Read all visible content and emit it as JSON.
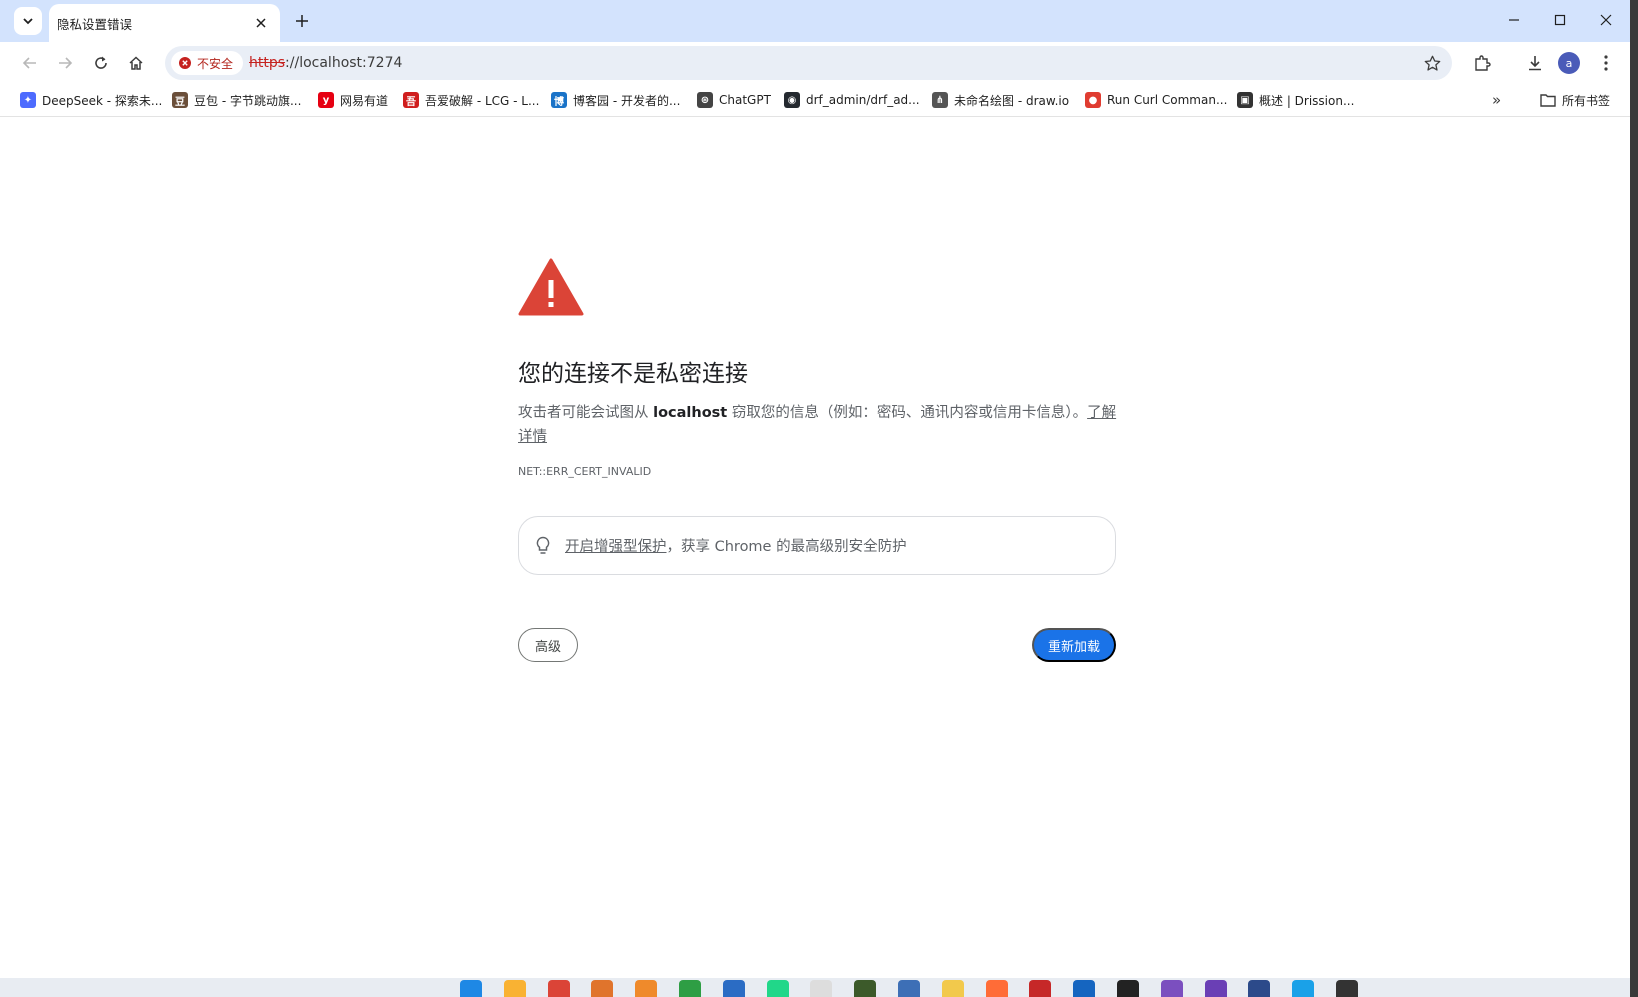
{
  "tab": {
    "title": "隐私设置错误"
  },
  "toolbar": {
    "security_chip": "不安全",
    "url_scheme": "https",
    "url_rest": "://localhost:7274",
    "avatar_letter": "a"
  },
  "bookmarks": [
    {
      "label": "DeepSeek - 探索未...",
      "color": "#4d6bfe",
      "glyph": "✦"
    },
    {
      "label": "豆包 - 字节跳动旗...",
      "color": "#6b4f3a",
      "glyph": "豆"
    },
    {
      "label": "网易有道",
      "color": "#e60012",
      "glyph": "y"
    },
    {
      "label": "吾爱破解 - LCG - L...",
      "color": "#d01e1e",
      "glyph": "吾"
    },
    {
      "label": "博客园 - 开发者的...",
      "color": "#1a73c8",
      "glyph": "博"
    },
    {
      "label": "ChatGPT",
      "color": "#444444",
      "glyph": "⊛"
    },
    {
      "label": "drf_admin/drf_ad...",
      "color": "#24292f",
      "glyph": "◉"
    },
    {
      "label": "未命名绘图 - draw.io",
      "color": "#555555",
      "glyph": "⋔"
    },
    {
      "label": "Run Curl Comman...",
      "color": "#e03c31",
      "glyph": "●"
    },
    {
      "label": "概述 | Drission...",
      "color": "#333333",
      "glyph": "▣"
    }
  ],
  "bookmarks_overflow": "»",
  "all_bookmarks": "所有书签",
  "interstitial": {
    "heading": "您的连接不是私密连接",
    "explanation_pre": "攻击者可能会试图从 ",
    "explanation_host": "localhost",
    "explanation_post": " 窃取您的信息（例如：密码、通讯内容或信用卡信息）。",
    "learn_more": "了解详情",
    "error_code": "NET::ERR_CERT_INVALID",
    "ssb_link": "开启增强型保护",
    "ssb_rest": "，获享 Chrome 的最高级别安全防护",
    "advanced_button": "高级",
    "reload_button": "重新加载"
  },
  "colors": {
    "tabstrip": "#d3e3fd",
    "omnibox": "#e9eef6",
    "warning_red": "#db4437",
    "primary_blue": "#1a73e8"
  },
  "taskbar_icons": [
    {
      "name": "windows-start-icon",
      "color": "#1e88e5"
    },
    {
      "name": "file-explorer-icon",
      "color": "#f9b233"
    },
    {
      "name": "chrome-icon",
      "color": "#db4437"
    },
    {
      "name": "app-orange-icon",
      "color": "#e0742c"
    },
    {
      "name": "app-sublime-icon",
      "color": "#ef8a2b"
    },
    {
      "name": "app-green-h-icon",
      "color": "#2e9e44"
    },
    {
      "name": "app-blue-icon",
      "color": "#2b6cc4"
    },
    {
      "name": "pycharm-icon",
      "color": "#21d789"
    },
    {
      "name": "typora-icon",
      "color": "#dddddd"
    },
    {
      "name": "app-dark-icon",
      "color": "#3c5a2a"
    },
    {
      "name": "app-bird-icon",
      "color": "#3d6fb6"
    },
    {
      "name": "app-yellow-icon",
      "color": "#f2c94c"
    },
    {
      "name": "postman-icon",
      "color": "#ff6c37"
    },
    {
      "name": "app-red-hex-icon",
      "color": "#c62828"
    },
    {
      "name": "webstorm-icon",
      "color": "#1565c0"
    },
    {
      "name": "app-black-icon",
      "color": "#222222"
    },
    {
      "name": "visual-studio-icon",
      "color": "#7b4fbf"
    },
    {
      "name": "visual-studio-2-icon",
      "color": "#6a3fb5"
    },
    {
      "name": "app-navy-icon",
      "color": "#2c4a8a"
    },
    {
      "name": "app-cyan-icon",
      "color": "#1aa1e8"
    },
    {
      "name": "terminal-icon",
      "color": "#333333"
    }
  ]
}
